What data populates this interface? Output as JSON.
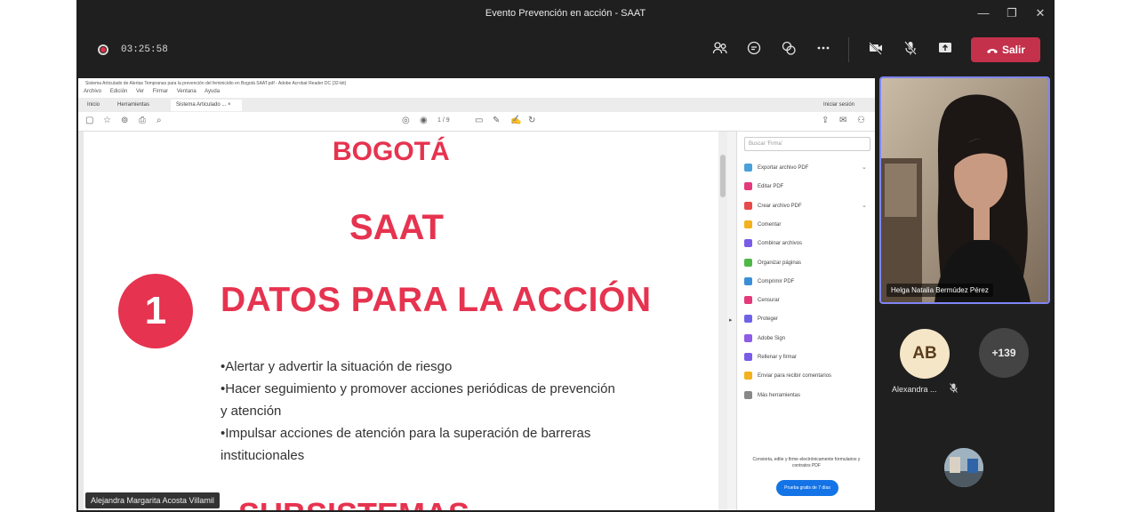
{
  "window": {
    "title": "Evento Prevención en acción - SAAT",
    "minimize": "—",
    "maximize": "❐",
    "close": "✕"
  },
  "toolbar": {
    "timer": "03:25:58",
    "leave_label": "Salir",
    "icons": [
      "people-icon",
      "chat-icon",
      "reactions-icon",
      "more-icon",
      "camera-off-icon",
      "mic-off-icon",
      "share-tray-icon",
      "phone-icon"
    ]
  },
  "acrobat": {
    "window_title": "Sistema Articulado de Alertas Tempranas para la prevención del feminicidio en Bogotá SAAT.pdf - Adobe Acrobat Reader DC (32-bit)",
    "menu": [
      "Archivo",
      "Edición",
      "Ver",
      "Firmar",
      "Ventana",
      "Ayuda"
    ],
    "tabs": [
      "Inicio",
      "Herramientas",
      "Sistema Articulado ..."
    ],
    "tab_close": "×",
    "sign_in": "Iniciar sesión",
    "page_indicator": "1 / 9",
    "tools_search_placeholder": "Buscar 'Firma'",
    "tools": [
      {
        "label": "Exportar archivo PDF",
        "color": "#4aa0d8"
      },
      {
        "label": "Editar PDF",
        "color": "#e4397a"
      },
      {
        "label": "Crear archivo PDF",
        "color": "#e84a4a"
      },
      {
        "label": "Comentar",
        "color": "#f3b21b"
      },
      {
        "label": "Combinar archivos",
        "color": "#7a5ce6"
      },
      {
        "label": "Organizar páginas",
        "color": "#4fb848"
      },
      {
        "label": "Comprimir PDF",
        "color": "#3b8fd8"
      },
      {
        "label": "Censurar",
        "color": "#e4397a"
      },
      {
        "label": "Proteger",
        "color": "#6f62e6"
      },
      {
        "label": "Adobe Sign",
        "color": "#8e5ce6"
      },
      {
        "label": "Rellenar y firmar",
        "color": "#7a5ce6"
      },
      {
        "label": "Enviar para recibir comentarios",
        "color": "#f3b21b"
      },
      {
        "label": "Más herramientas",
        "color": "#888888"
      }
    ],
    "footer_text": "Convierta, edite y firme electrónicamente formularios y contratos PDF",
    "trial_button": "Prueba gratis de 7 días"
  },
  "slide": {
    "city": "BOGOTÁ",
    "acronym": "SAAT",
    "section_number": "1",
    "section_title": "DATOS PARA LA ACCIÓN",
    "bullets": [
      "•Alertar y advertir la situación de riesgo",
      "•Hacer seguimiento y promover acciones periódicas de prevención",
      "y atención",
      "•Impulsar acciones de atención para la superación de barreras",
      "institucionales"
    ],
    "next_heading_partial": "SUBSISTEMAS"
  },
  "presenter_name": "Alejandra Margarita Acosta Villamil",
  "participants": {
    "speaker_name": "Helga Natalia Bermúdez Pérez",
    "avatar_initials": "AB",
    "avatar_name": "Alexandra ...",
    "more_count": "+139"
  },
  "colors": {
    "accent": "#e6334f",
    "leave": "#c4314b",
    "speaker_border": "#7f85f5"
  }
}
